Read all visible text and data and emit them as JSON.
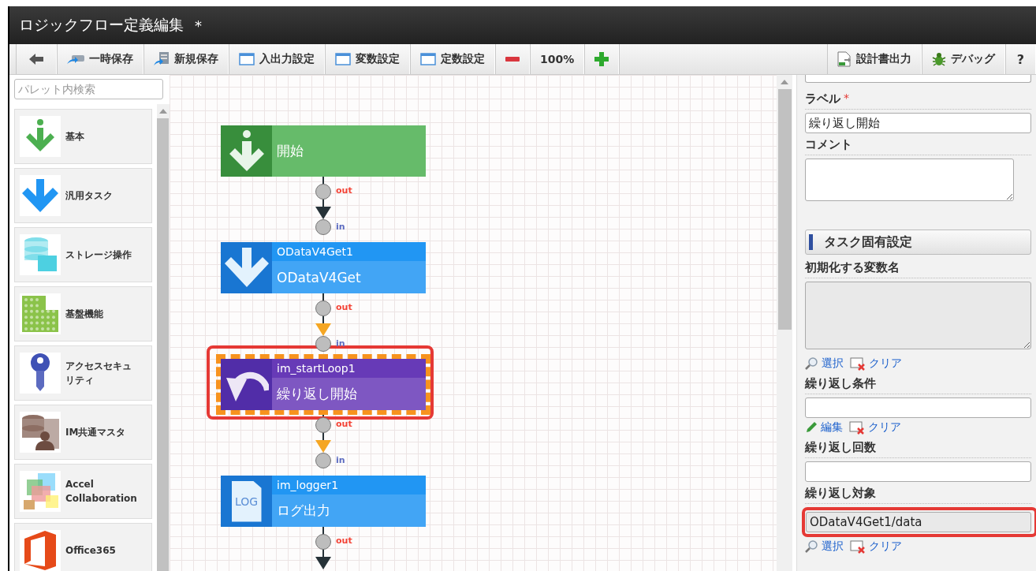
{
  "window": {
    "title": "ロジックフロー定義編集",
    "modified_mark": "*"
  },
  "toolbar": {
    "left": [
      {
        "kind": "back"
      },
      {
        "kind": "temp_save",
        "label": "一時保存"
      },
      {
        "kind": "new_save",
        "label": "新規保存"
      },
      {
        "kind": "window",
        "label": "入出力設定"
      },
      {
        "kind": "window",
        "label": "変数設定"
      },
      {
        "kind": "window",
        "label": "定数設定"
      },
      {
        "kind": "zoom_out"
      },
      {
        "kind": "zoom_level",
        "label": "100%"
      },
      {
        "kind": "zoom_in"
      }
    ],
    "right": [
      {
        "kind": "document",
        "label": "設計書出力"
      },
      {
        "kind": "debug",
        "label": "デバッグ"
      },
      {
        "kind": "help",
        "label": "?"
      }
    ]
  },
  "palette": {
    "search": {
      "placeholder": "パレット内検索"
    },
    "items": [
      {
        "kind": "basic",
        "label": "基本"
      },
      {
        "kind": "generic",
        "label": "汎用タスク"
      },
      {
        "kind": "storage",
        "label": "ストレージ操作"
      },
      {
        "kind": "platform",
        "label": "基盤機能"
      },
      {
        "kind": "security",
        "label": "アクセスセキュリティ"
      },
      {
        "kind": "master",
        "label": "IM共通マスタ"
      },
      {
        "kind": "accel",
        "label": "Accel Collaboration"
      },
      {
        "kind": "office",
        "label": "Office365"
      }
    ]
  },
  "canvas": {
    "nodes": [
      {
        "kind": "start",
        "label": "開始",
        "selected": false,
        "out_port": "out"
      },
      {
        "kind": "task",
        "name": "ODataV4Get1",
        "label": "ODataV4Get",
        "selected": false,
        "in_port": "in",
        "out_port": "out"
      },
      {
        "kind": "loop",
        "name": "im_startLoop1",
        "label": "繰り返し開始",
        "selected": true,
        "highlighted": true,
        "in_port": "in",
        "out_port": "out"
      },
      {
        "kind": "log",
        "name": "im_logger1",
        "label": "ログ出力",
        "icon_text": "LOG",
        "selected": false,
        "in_port": "in",
        "out_port": "out"
      }
    ],
    "edges": [
      {
        "color": "#263238"
      },
      {
        "color": "#f5a623"
      },
      {
        "color": "#f5a623"
      },
      {
        "color": "#263238"
      }
    ]
  },
  "properties": [
    {
      "kind": "stub"
    },
    {
      "kind": "label",
      "text": "ラベル",
      "required_mark": "*"
    },
    {
      "kind": "input",
      "value": "繰り返し開始",
      "disabled": false
    },
    {
      "kind": "label",
      "text": "コメント"
    },
    {
      "kind": "textarea",
      "disabled": false
    },
    {
      "kind": "section",
      "text": "タスク固有設定"
    },
    {
      "kind": "label",
      "text": "初期化する変数名"
    },
    {
      "kind": "textarea",
      "disabled": true
    },
    {
      "kind": "links",
      "links": [
        {
          "kind": "select",
          "text": "選択"
        },
        {
          "kind": "clear",
          "text": "クリア"
        }
      ]
    },
    {
      "kind": "label",
      "text": "繰り返し条件"
    },
    {
      "kind": "input",
      "disabled": false
    },
    {
      "kind": "links",
      "links": [
        {
          "kind": "edit",
          "text": "編集"
        },
        {
          "kind": "clear",
          "text": "クリア"
        }
      ]
    },
    {
      "kind": "label",
      "text": "繰り返し回数"
    },
    {
      "kind": "input",
      "disabled": false
    },
    {
      "kind": "label",
      "text": "繰り返し対象"
    },
    {
      "kind": "input",
      "value": "ODataV4Get1/data",
      "disabled": true,
      "highlighted": true
    },
    {
      "kind": "links",
      "links": [
        {
          "kind": "select",
          "text": "選択"
        },
        {
          "kind": "clear",
          "text": "クリア"
        }
      ]
    }
  ]
}
